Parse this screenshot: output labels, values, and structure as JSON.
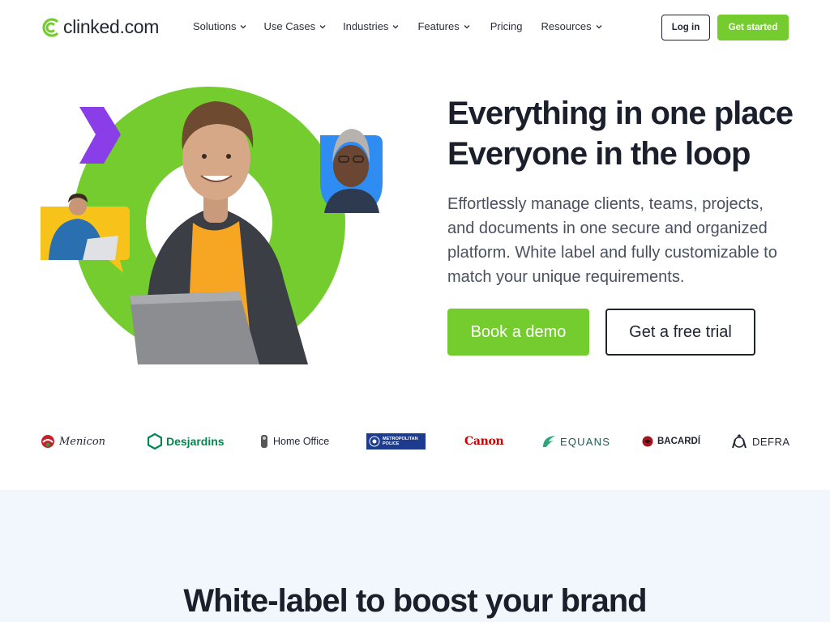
{
  "brand": {
    "name": "clinked.com",
    "accent": "#74cc2f",
    "dark": "#1f2430"
  },
  "nav": {
    "items": [
      {
        "label": "Solutions",
        "dropdown": true
      },
      {
        "label": "Use Cases",
        "dropdown": true
      },
      {
        "label": "Industries",
        "dropdown": true
      },
      {
        "label": "Features",
        "dropdown": true
      },
      {
        "label": "Pricing",
        "dropdown": false
      },
      {
        "label": "Resources",
        "dropdown": true
      }
    ],
    "login_label": "Log in",
    "get_started_label": "Get started"
  },
  "hero": {
    "title_line1": "Everything in one place",
    "title_line2": "Everyone in the loop",
    "subtitle": "Effortlessly manage clients, teams, projects, and documents in one secure and organized platform. White label and fully customizable to match your unique requirements.",
    "demo_label": "Book a demo",
    "trial_label": "Get a free trial"
  },
  "client_logos": [
    {
      "name": "Menicon",
      "color": "#c8202a"
    },
    {
      "name": "Desjardins",
      "color": "#00874e"
    },
    {
      "name": "Home Office",
      "color": "#1f2430"
    },
    {
      "name": "METROPOLITAN POLICE",
      "color": "#1d3c8f"
    },
    {
      "name": "Canon",
      "color": "#cc0000"
    },
    {
      "name": "EQUANS",
      "color": "#1a5c52"
    },
    {
      "name": "BACARDÍ",
      "color": "#1f2430"
    },
    {
      "name": "DEFRA",
      "color": "#1f2430"
    }
  ],
  "section2": {
    "title": "White-label to boost your brand"
  }
}
